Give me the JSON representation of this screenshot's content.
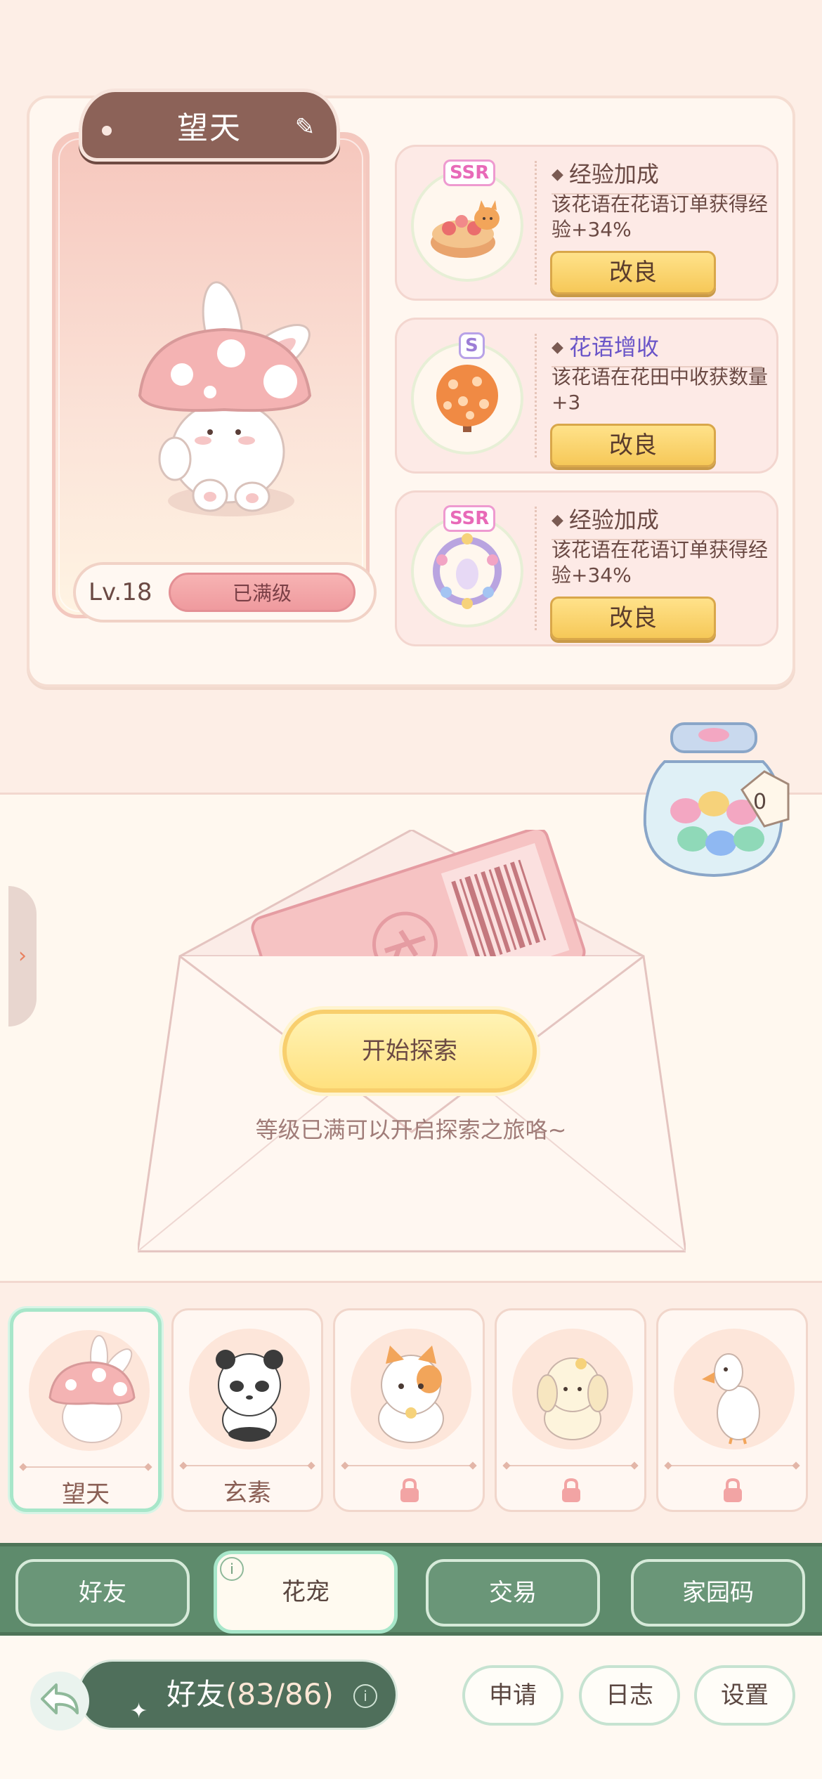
{
  "pet": {
    "name": "望天",
    "level": "Lv.18",
    "level_status": "已满级"
  },
  "traits": [
    {
      "rarity": "SSR",
      "title": "经验加成",
      "title_color": "#6b4a44",
      "desc": "该花语在花语订单获得经验+34%",
      "button": "改良",
      "icon": "fox-cake-icon"
    },
    {
      "rarity": "S",
      "title": "花语增收",
      "title_color": "#6a55c8",
      "desc": "该花语在花田中收获数量+3",
      "button": "改良",
      "icon": "flower-tree-icon"
    },
    {
      "rarity": "SSR",
      "title": "经验加成",
      "title_color": "#6b4a44",
      "desc": "该花语在花语订单获得经验+34%",
      "button": "改良",
      "icon": "flower-wreath-icon"
    }
  ],
  "jar": {
    "count": "0"
  },
  "explore": {
    "start_label": "开始探索",
    "hint": "等级已满可以开启探索之旅咯~"
  },
  "pet_slots": [
    {
      "name": "望天",
      "locked": false,
      "active": true
    },
    {
      "name": "玄素",
      "locked": false,
      "active": false
    },
    {
      "name": "",
      "locked": true,
      "active": false
    },
    {
      "name": "",
      "locked": true,
      "active": false
    },
    {
      "name": "",
      "locked": true,
      "active": false
    }
  ],
  "tabs": [
    {
      "label": "好友",
      "active": false
    },
    {
      "label": "花宠",
      "active": true
    },
    {
      "label": "交易",
      "active": false
    },
    {
      "label": "家园码",
      "active": false
    }
  ],
  "bottom": {
    "friends_label": "好友",
    "friends_count": "(83/86)",
    "apply": "申请",
    "log": "日志",
    "settings": "设置"
  },
  "colors": {
    "background": "#fdeee6",
    "tab_bar": "#5e8b6c",
    "accent_mint": "#a7e6c9",
    "button_yellow": "#ffe28a"
  }
}
